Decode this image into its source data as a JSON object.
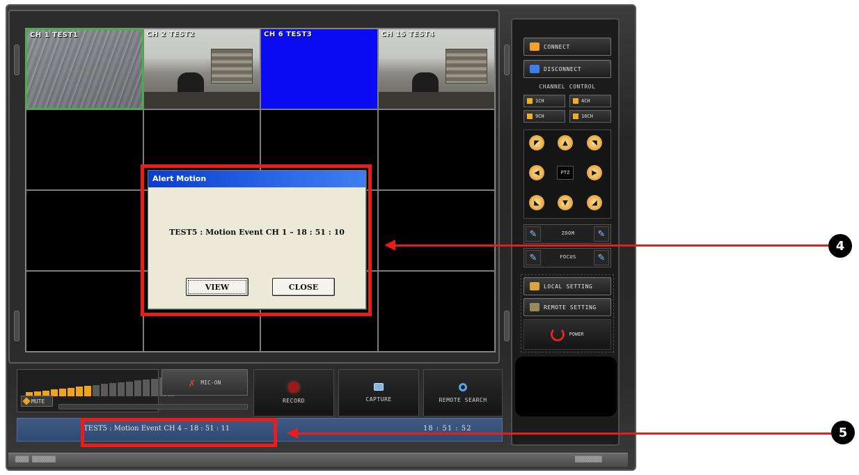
{
  "grid": {
    "cells": [
      {
        "label": "CH 1 TEST1",
        "feed": "outdoor",
        "active": true
      },
      {
        "label": "CH 2 TEST2",
        "feed": "office",
        "active": false
      },
      {
        "label": "CH 6 TEST3",
        "feed": "blue",
        "active": false
      },
      {
        "label": "CH 15 TEST4",
        "feed": "office",
        "active": false
      },
      {
        "label": "",
        "feed": "empty"
      },
      {
        "label": "",
        "feed": "empty"
      },
      {
        "label": "",
        "feed": "empty"
      },
      {
        "label": "",
        "feed": "empty"
      },
      {
        "label": "",
        "feed": "empty"
      },
      {
        "label": "",
        "feed": "empty"
      },
      {
        "label": "",
        "feed": "empty"
      },
      {
        "label": "",
        "feed": "empty"
      },
      {
        "label": "",
        "feed": "empty"
      },
      {
        "label": "",
        "feed": "empty"
      },
      {
        "label": "",
        "feed": "empty"
      },
      {
        "label": "",
        "feed": "empty"
      }
    ]
  },
  "alert": {
    "title": "Alert Motion",
    "message": "TEST5 : Motion Event CH 1 – 18 : 51 : 10",
    "view_label": "VIEW",
    "close_label": "CLOSE"
  },
  "audio": {
    "mute_label": "MUTE",
    "mic_label": "MIC-ON",
    "volume_level": 0.45
  },
  "actions": {
    "record_label": "RECORD",
    "capture_label": "CAPTURE",
    "remote_search_label": "REMOTE SEARCH"
  },
  "status": {
    "message": "TEST5 : Motion Event CH 4 – 18 : 51 : 11",
    "time": "18 : 51 : 52"
  },
  "right_panel": {
    "connect_label": "CONNECT",
    "disconnect_label": "DISCONNECT",
    "channel_control_label": "CHANNEL CONTROL",
    "ch1_label": "1CH",
    "ch4_label": "4CH",
    "ch9_label": "9CH",
    "ch16_label": "16CH",
    "ptz_label": "PTZ",
    "zoom_label": "ZOOM",
    "focus_label": "FOCUS",
    "local_setting_label": "LOCAL SETTING",
    "remote_setting_label": "REMOTE SETTING",
    "power_label": "POWER"
  },
  "callouts": {
    "alert_marker": "4",
    "status_marker": "5"
  },
  "colors": {
    "highlight": "#ea1c1c",
    "accent_orange": "#f0a416",
    "active_channel_border": "#2fc12f"
  }
}
